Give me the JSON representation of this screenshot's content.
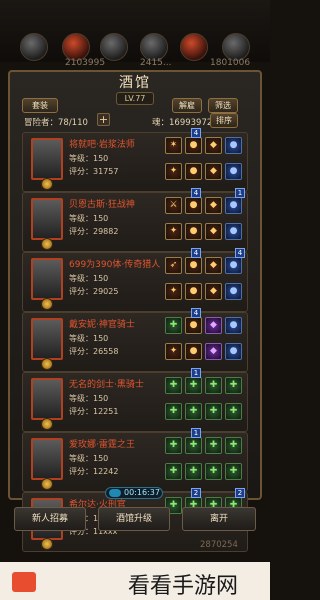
{
  "top": {
    "numbers": [
      "2103995",
      "2415...",
      "1801006"
    ]
  },
  "panel": {
    "title": "酒馆",
    "level_badge": "LV.77",
    "set_button": "套装",
    "dismiss_button": "解雇",
    "filter_button": "筛选",
    "adventurer_count": "冒险者：78/110",
    "souls_label": "魂：16993972",
    "sort_button": "排序"
  },
  "heroes": [
    {
      "name": "将就吧·岩浆法师",
      "level": "等级：150",
      "score": "评分：31757",
      "slots_row1": [
        "✶",
        "●",
        "◆",
        "●"
      ],
      "slots_row2": [
        "✦",
        "●",
        "◆",
        "●"
      ],
      "badges": [
        "4"
      ]
    },
    {
      "name": "贝恩古斯·狂战神",
      "level": "等级：150",
      "score": "评分：29882",
      "slots_row1": [
        "⚔",
        "●",
        "◆",
        "●"
      ],
      "slots_row2": [
        "✦",
        "●",
        "◆",
        "●"
      ],
      "badges": [
        "4",
        "1"
      ]
    },
    {
      "name": "699为390体·传奇猎人",
      "level": "等级：150",
      "score": "评分：29025",
      "slots_row1": [
        "➶",
        "●",
        "◆",
        "●"
      ],
      "slots_row2": [
        "✦",
        "●",
        "◆",
        "●"
      ],
      "badges": [
        "4",
        "4"
      ]
    },
    {
      "name": "戴安妮·神官骑士",
      "level": "等级：150",
      "score": "评分：26558",
      "slots_row1": [
        "✚",
        "●",
        "◆",
        "●"
      ],
      "slots_row2": [
        "✦",
        "●",
        "◆",
        "●"
      ],
      "badges": [
        "4"
      ]
    },
    {
      "name": "无名的剑士·黑骑士",
      "level": "等级：150",
      "score": "评分：12251",
      "slots_row1": [
        "✚",
        "✚",
        "✚",
        "✚"
      ],
      "slots_row2": [
        "✚",
        "✚",
        "✚",
        "✚"
      ],
      "badges": [
        "1"
      ]
    },
    {
      "name": "爱玫娜·雷霆之王",
      "level": "等级：150",
      "score": "评分：12242",
      "slots_row1": [
        "✚",
        "✚",
        "✚",
        "✚"
      ],
      "slots_row2": [
        "✚",
        "✚",
        "✚",
        "✚"
      ],
      "badges": [
        "1"
      ]
    },
    {
      "name": "希尔达·火刑官",
      "level": "等级：150",
      "score": "评分：11xxx",
      "slots_row1": [
        "✚",
        "✚",
        "✚",
        "✚"
      ],
      "slots_row2": [],
      "badges": [
        "2",
        "2"
      ]
    }
  ],
  "timer": "00:16:37",
  "bottom": {
    "recruit": "新人招募",
    "upgrade": "酒馆升级",
    "leave": "离开"
  },
  "bottom_extra": "2870254",
  "watermark": "看看手游网"
}
